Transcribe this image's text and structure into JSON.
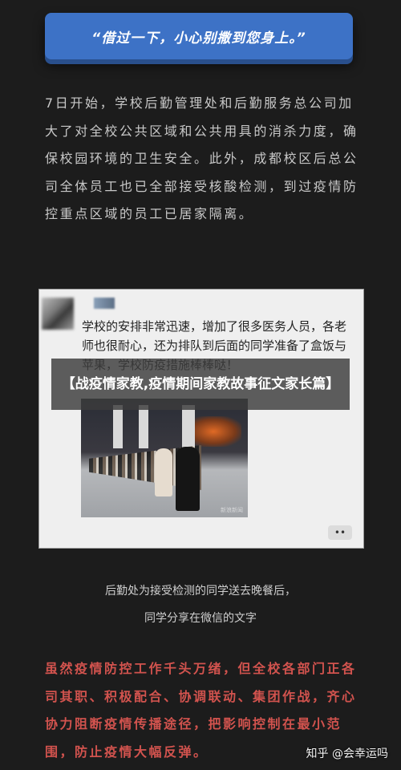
{
  "quote": "“借过一下，小心别撒到您身上。”",
  "intro_paragraph": "7日开始，学校后勤管理处和后勤服务总公司加大了对全校公共区域和公共用具的消杀力度，确保校园环境的卫生安全。此外，成都校区后总公司全体员工也已全部接受核酸检测，到过疫情防控重点区域的员工已居家隔离。",
  "chat_screenshot": {
    "message": "学校的安排非常迅速，增加了很多医务人员，各老师也很耐心，还为排队到后面的同学准备了盒饭与苹果，学校防疫措施棒棒哒！",
    "photo_watermark": "新浪新闻",
    "menu_icon": "more-dots-icon",
    "menu_glyph": "••"
  },
  "overlay_title": "【战疫情家教,疫情期间家教故事征文家长篇】",
  "caption_line1": "后勤处为接受检测的同学送去晚餐后，",
  "caption_line2": "同学分享在微信的文字",
  "red_paragraph": "虽然疫情防控工作千头万绪，但全校各部门正各司其职、积极配合、协调联动、集团作战，齐心协力阻断疫情传播途径，把影响控制在最小范围，防止疫情大幅反弹。",
  "watermark": "知乎 @会幸运吗",
  "colors": {
    "quote_box": "#3d72c6",
    "red_text": "#d2534e",
    "background": "#1c1c1c"
  }
}
